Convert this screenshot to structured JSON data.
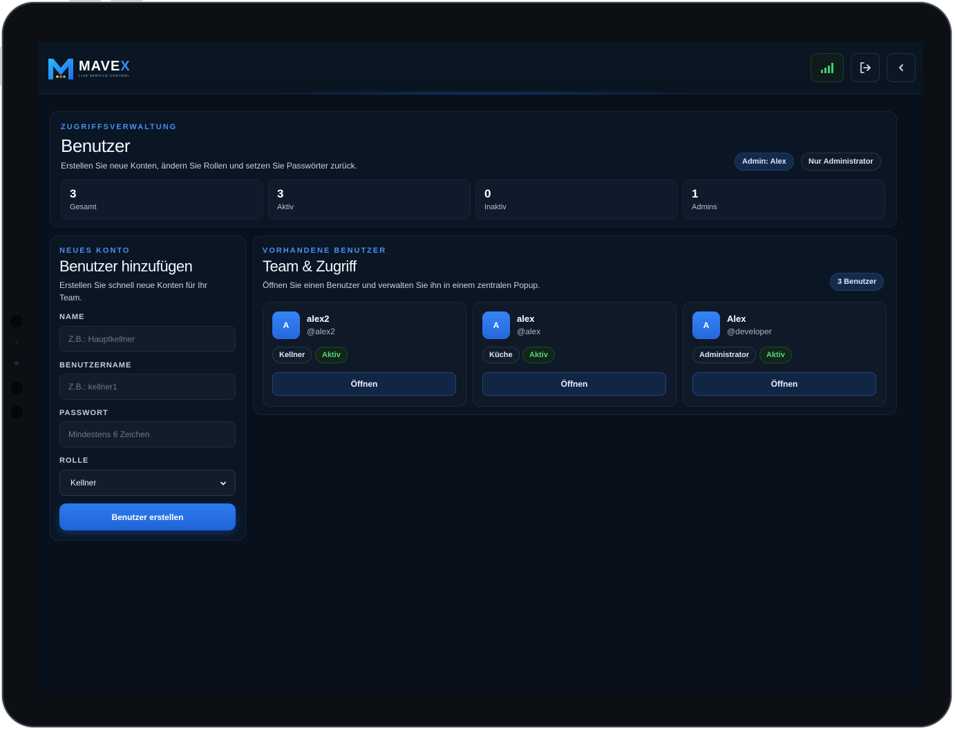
{
  "brand": {
    "name": "MAVE",
    "name_accent": "X",
    "tagline": "LIVE SERVICE CONTROL"
  },
  "topbar": {
    "signal_icon": "signal-bars-icon",
    "logout_icon": "logout-icon",
    "back_icon": "chevron-left-icon",
    "signal_color": "#3fcf6e"
  },
  "header": {
    "eyebrow": "ZUGRIFFSVERWALTUNG",
    "title": "Benutzer",
    "subtitle": "Erstellen Sie neue Konten, ändern Sie Rollen und setzen Sie Passwörter zurück.",
    "badges": [
      "Admin: Alex",
      "Nur Administrator"
    ],
    "stats": [
      {
        "value": "3",
        "label": "Gesamt"
      },
      {
        "value": "3",
        "label": "Aktiv"
      },
      {
        "value": "0",
        "label": "Inaktiv"
      },
      {
        "value": "1",
        "label": "Admins"
      }
    ]
  },
  "new_account": {
    "eyebrow": "NEUES KONTO",
    "title": "Benutzer hinzufügen",
    "subtitle": "Erstellen Sie schnell neue Konten für Ihr Team.",
    "fields": {
      "name": {
        "label": "NAME",
        "placeholder": "Z.B.: Hauptkellner",
        "value": ""
      },
      "username": {
        "label": "BENUTZERNAME",
        "placeholder": "Z.B.: kellner1",
        "value": ""
      },
      "password": {
        "label": "PASSWORT",
        "placeholder": "Mindestens 6 Zeichen",
        "value": ""
      },
      "role": {
        "label": "ROLLE",
        "selected": "Kellner"
      }
    },
    "submit_label": "Benutzer erstellen"
  },
  "team": {
    "eyebrow": "VORHANDENE BENUTZER",
    "title": "Team & Zugriff",
    "subtitle": "Öffnen Sie einen Benutzer und verwalten Sie ihn in einem zentralen Popup.",
    "count_badge": "3 Benutzer",
    "users": [
      {
        "initial": "A",
        "name": "alex2",
        "handle": "@alex2",
        "role": "Kellner",
        "status": "Aktiv",
        "open_label": "Öffnen"
      },
      {
        "initial": "A",
        "name": "alex",
        "handle": "@alex",
        "role": "Küche",
        "status": "Aktiv",
        "open_label": "Öffnen"
      },
      {
        "initial": "A",
        "name": "Alex",
        "handle": "@developer",
        "role": "Administrator",
        "status": "Aktiv",
        "open_label": "Öffnen"
      }
    ]
  },
  "colors": {
    "accent": "#2d7bf0",
    "success": "#5ad184",
    "background": "#08101b"
  }
}
